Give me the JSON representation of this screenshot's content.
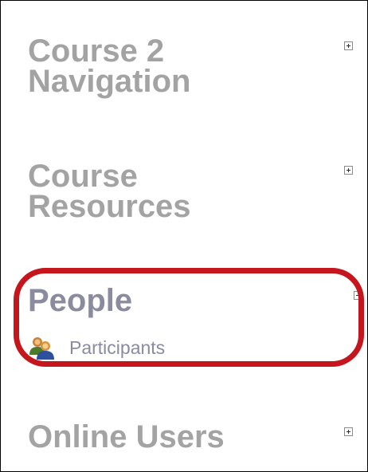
{
  "blocks": {
    "course_navigation": {
      "title_line1": "Course 2",
      "title_line2": "Navigation"
    },
    "course_resources": {
      "title_line1": "Course",
      "title_line2": "Resources"
    },
    "people": {
      "title": "People",
      "items": [
        {
          "label": "Participants",
          "icon": "users-icon"
        }
      ]
    },
    "online_users": {
      "title": "Online Users"
    }
  },
  "colors": {
    "heading_gray": "#a3a3a3",
    "people_heading": "#8b8ba0",
    "highlight": "#c4161c"
  }
}
